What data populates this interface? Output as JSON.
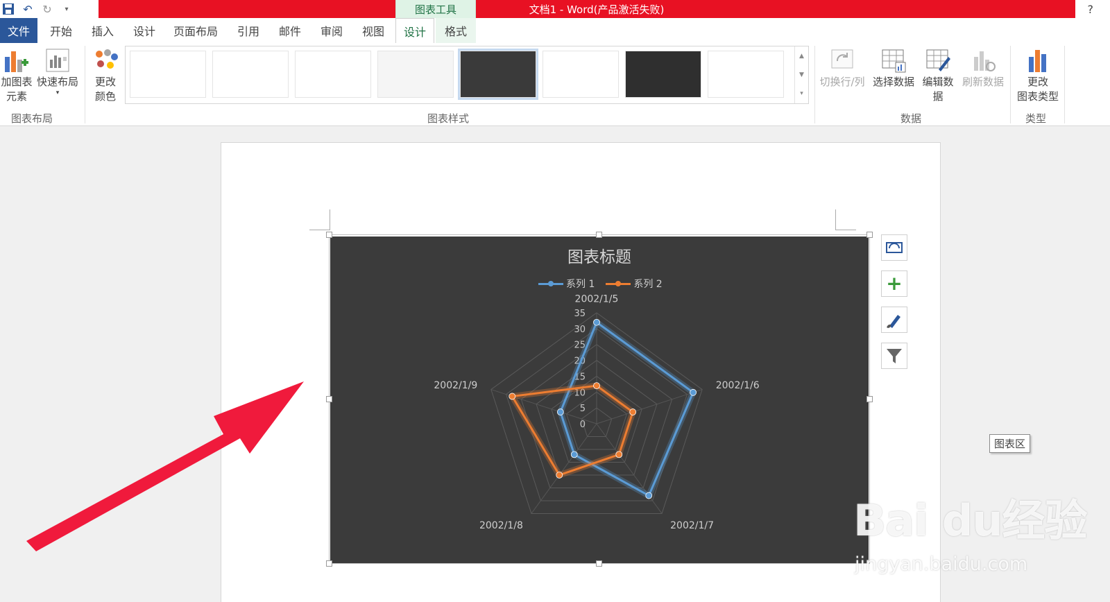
{
  "window": {
    "title": "文档1 -  Word(产品激活失败)",
    "context_tab_group": "图表工具",
    "help": "?"
  },
  "tabs": [
    {
      "label": "文件"
    },
    {
      "label": "开始"
    },
    {
      "label": "插入"
    },
    {
      "label": "设计"
    },
    {
      "label": "页面布局"
    },
    {
      "label": "引用"
    },
    {
      "label": "邮件"
    },
    {
      "label": "审阅"
    },
    {
      "label": "视图"
    },
    {
      "label": "设计"
    },
    {
      "label": "格式"
    }
  ],
  "ribbon": {
    "add_chart_element": "加图表\n元素",
    "quick_layout": "快速布局",
    "change_colors": "更改\n颜色",
    "group_chart_layouts": "图表布局",
    "group_chart_styles": "图表样式",
    "switch_row_col": "切换行/列",
    "select_data": "选择数据",
    "edit_data": "编辑数\n据",
    "refresh_data": "刷新数据",
    "group_data": "数据",
    "change_chart_type": "更改\n图表类型",
    "group_type": "类型"
  },
  "tooltip": "图表区",
  "watermark": {
    "brand": "Bai du经验",
    "url": "jingyan.baidu.com"
  },
  "colors": {
    "series1": "#5b9bd5",
    "series2": "#ed7d31",
    "file_tab": "#2b579a",
    "accent_green": "#217346",
    "title_bar": "#e81123",
    "chart_bg": "#3b3b3b"
  },
  "chart_data": {
    "type": "radar",
    "title": "图表标题",
    "categories": [
      "2002/1/5",
      "2002/1/6",
      "2002/1/7",
      "2002/1/8",
      "2002/1/9"
    ],
    "series": [
      {
        "name": "系列 1",
        "values": [
          32,
          32,
          28,
          12,
          12
        ]
      },
      {
        "name": "系列 2",
        "values": [
          12,
          12,
          12,
          20,
          28
        ]
      }
    ],
    "axis_ticks": [
      0,
      5,
      10,
      15,
      20,
      25,
      30,
      35
    ],
    "ylim": [
      0,
      35
    ],
    "legend": "top"
  }
}
